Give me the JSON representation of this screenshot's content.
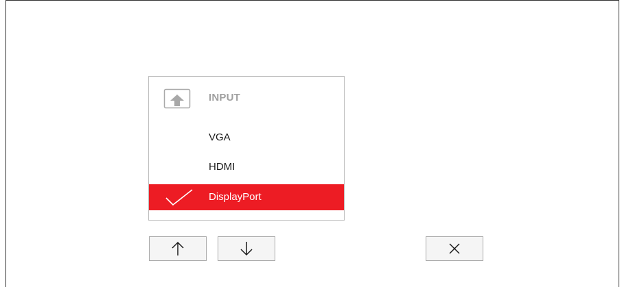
{
  "osd": {
    "header": {
      "icon": "input-source-icon",
      "title": "INPUT"
    },
    "items": [
      {
        "label": "VGA",
        "selected": false
      },
      {
        "label": "HDMI",
        "selected": false
      },
      {
        "label": "DisplayPort",
        "selected": true
      }
    ],
    "selected_icon": "checkmark-icon"
  },
  "controls": {
    "up_icon": "arrow-up-icon",
    "down_icon": "arrow-down-icon",
    "close_icon": "close-icon"
  },
  "colors": {
    "accent": "#ed1c24",
    "header_text": "#a0a0a0",
    "item_text": "#1a1a1a",
    "selected_text": "#ffffff",
    "panel_border": "#bdbdbd",
    "button_bg": "#f5f5f5"
  }
}
